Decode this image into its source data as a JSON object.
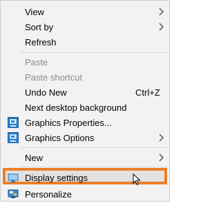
{
  "menu": {
    "view": "View",
    "sort_by": "Sort by",
    "refresh": "Refresh",
    "paste": "Paste",
    "paste_shortcut": "Paste shortcut",
    "undo_new": "Undo New",
    "undo_shortcut": "Ctrl+Z",
    "next_background": "Next desktop background",
    "graphics_properties": "Graphics Properties...",
    "graphics_options": "Graphics Options",
    "new": "New",
    "display_settings": "Display settings",
    "personalize": "Personalize"
  },
  "icons": {
    "graphics_properties": "intel-graphics-icon",
    "graphics_options": "intel-graphics-icon",
    "display_settings": "display-monitor-icon",
    "personalize": "personalize-desktop-icon"
  },
  "colors": {
    "menu_bg": "#f2f2f2",
    "highlight_border": "#ea7f2a",
    "disabled_text": "#8a8a8a"
  }
}
